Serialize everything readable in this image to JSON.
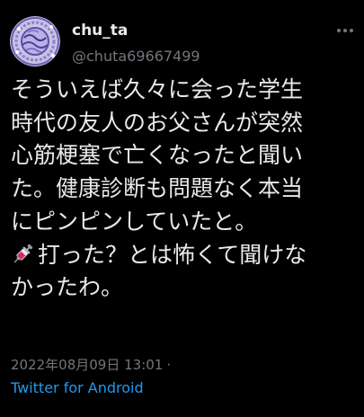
{
  "tweet": {
    "author": {
      "display_name": "chu_ta",
      "handle": "@chuta69667499",
      "avatar_icon": "circular-lace-pattern-avatar"
    },
    "more_icon": "more-dots-icon",
    "text_lines": [
      "そういえば久々に会った学生",
      "時代の友人のお父さんが突然",
      "心筋梗塞で亡くなったと聞い",
      "た。健康診断も問題なく本当",
      "にピンピンしていたと。",
      "打った？とは怖くて聞けな",
      "かったわ。"
    ],
    "inline_emoji": "syringe-icon",
    "timestamp": "2022年08月09日 13:01",
    "separator": "·",
    "source": "Twitter for Android"
  },
  "colors": {
    "background": "#000000",
    "text_primary": "#e7e9ea",
    "text_secondary": "#71767b",
    "link": "#1d9bf0"
  }
}
